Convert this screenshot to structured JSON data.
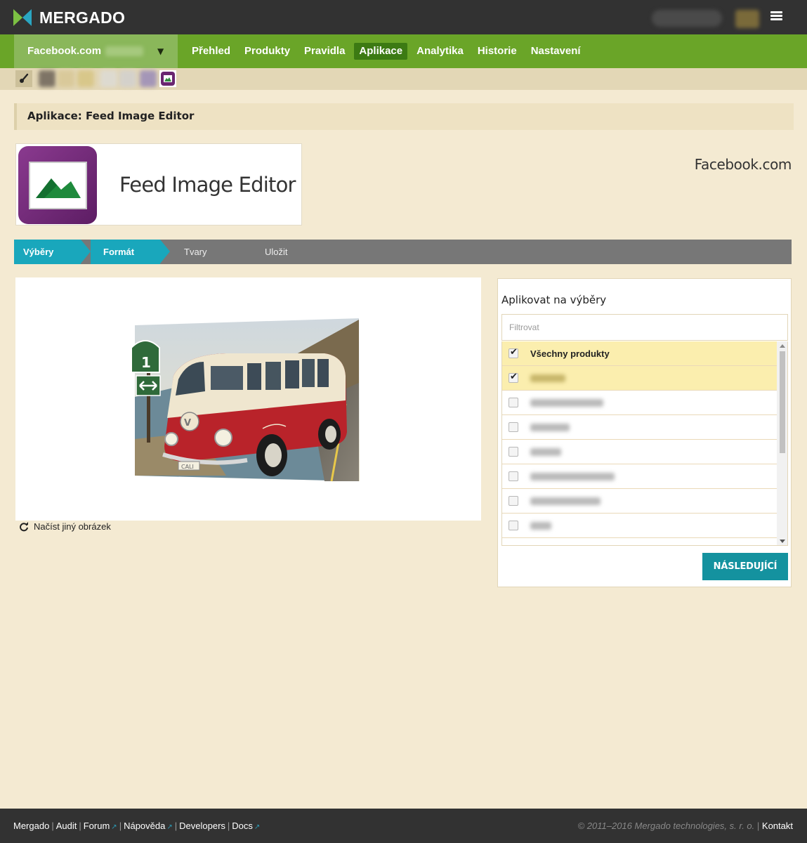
{
  "brand": {
    "name": "MERGADO"
  },
  "shop": {
    "name": "Facebook.com"
  },
  "nav": {
    "items": [
      {
        "label": "Přehled"
      },
      {
        "label": "Produkty"
      },
      {
        "label": "Pravidla"
      },
      {
        "label": "Aplikace",
        "active": true
      },
      {
        "label": "Analytika"
      },
      {
        "label": "Historie"
      },
      {
        "label": "Nastavení"
      }
    ]
  },
  "page": {
    "heading": "Aplikace: Feed Image Editor",
    "app_title": "Feed Image Editor",
    "channel": "Facebook.com"
  },
  "steps": [
    {
      "label": "Výběry",
      "state": "done"
    },
    {
      "label": "Formát",
      "state": "done"
    },
    {
      "label": "Tvary",
      "state": "todo"
    },
    {
      "label": "Uložit",
      "state": "todo"
    }
  ],
  "image_panel": {
    "reload_label": "Načíst jiný obrázek",
    "plate_text": "CALI"
  },
  "apply_panel": {
    "title": "Aplikovat na výběry",
    "filter_placeholder": "Filtrovat",
    "rows": [
      {
        "label": "Všechny produkty",
        "checked": true
      },
      {
        "label": "",
        "checked": true
      },
      {
        "label": "",
        "checked": false
      },
      {
        "label": "",
        "checked": false
      },
      {
        "label": "",
        "checked": false
      },
      {
        "label": "",
        "checked": false
      },
      {
        "label": "",
        "checked": false
      },
      {
        "label": "",
        "checked": false
      }
    ],
    "next_label": "NÁSLEDUJÍCÍ"
  },
  "footer": {
    "links": [
      {
        "label": "Mergado",
        "external": false
      },
      {
        "label": "Audit",
        "external": false
      },
      {
        "label": "Forum",
        "external": true
      },
      {
        "label": "Nápověda",
        "external": true
      },
      {
        "label": "Developers",
        "external": false
      },
      {
        "label": "Docs",
        "external": true
      }
    ],
    "copyright": "© 2011–2016 Mergado technologies, s. r. o.",
    "contact": "Kontakt"
  },
  "colors": {
    "accent_green": "#6aa528",
    "step_blue": "#19a7bc",
    "button_teal": "#14929f",
    "page_bg": "#f4ead2"
  }
}
